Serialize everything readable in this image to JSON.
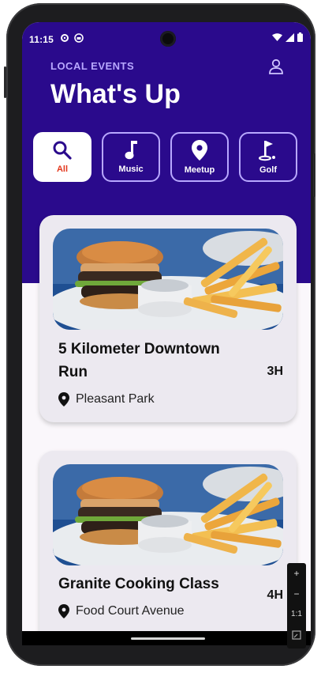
{
  "status_bar": {
    "time": "11:15"
  },
  "header": {
    "eyebrow": "LOCAL EVENTS",
    "title": "What's Up"
  },
  "categories": [
    {
      "label": "All",
      "icon": "search-icon",
      "active": true
    },
    {
      "label": "Music",
      "icon": "music-note-icon",
      "active": false
    },
    {
      "label": "Meetup",
      "icon": "location-pin-icon",
      "active": false
    },
    {
      "label": "Golf",
      "icon": "golf-flag-icon",
      "active": false
    }
  ],
  "events": [
    {
      "title": "5 Kilometer Downtown Run",
      "time": "3H",
      "location": "Pleasant Park",
      "image": "burger-and-fries-photo"
    },
    {
      "title": "Granite Cooking Class",
      "time": "4H",
      "location": "Food Court Avenue",
      "image": "burger-and-fries-photo"
    }
  ],
  "emulator_zoom": {
    "zoom_in": "+",
    "zoom_out": "−",
    "ratio": "1:1"
  },
  "colors": {
    "header": "#2a0a8c",
    "accent": "#e3361b",
    "chip_border": "#b8a8ff",
    "card": "#ece9f0"
  }
}
